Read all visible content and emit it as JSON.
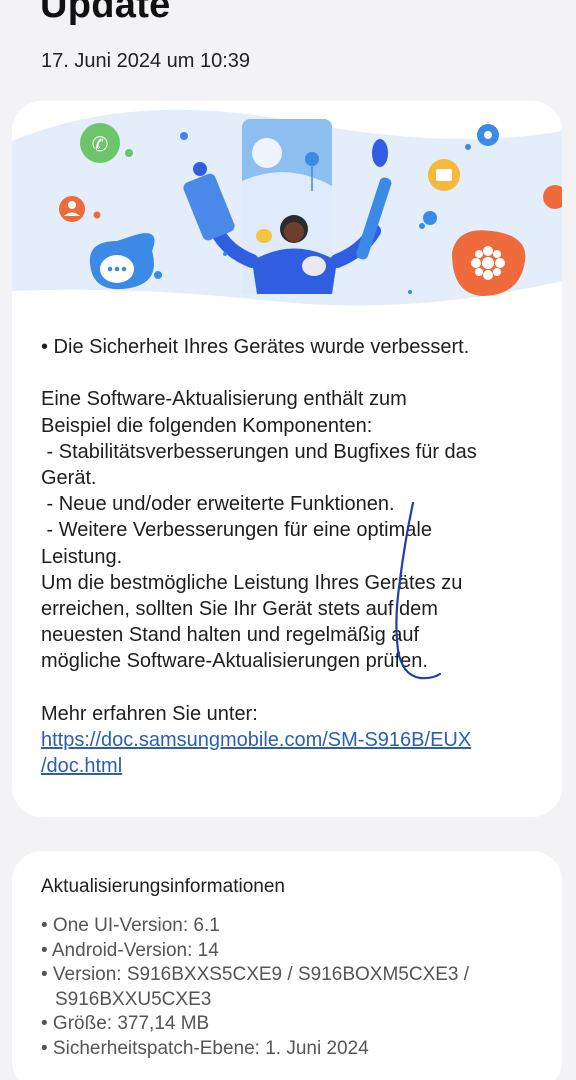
{
  "header": {
    "title": "Update",
    "date": "17. Juni 2024 um 10:39"
  },
  "notes": {
    "lines": [
      "• Die Sicherheit Ihres Gerätes wurde verbessert.",
      "",
      "Eine Software-Aktualisierung enthält zum",
      "Beispiel die folgenden Komponenten:",
      " - Stabilitätsverbesserungen und Bugfixes für das",
      "Gerät.",
      " - Neue und/oder erweiterte Funktionen.",
      " - Weitere Verbesserungen für eine optimale",
      "Leistung.",
      "Um die bestmögliche Leistung Ihres Gerätes zu",
      "erreichen, sollten Sie Ihr Gerät stets auf dem",
      "neuesten Stand halten und regelmäßig auf",
      "mögliche Software-Aktualisierungen prüfen.",
      "",
      "Mehr erfahren Sie unter:"
    ],
    "link_line1": "https://doc.samsungmobile.com/SM-S916B/EUX",
    "link_line2": "/doc.html"
  },
  "info": {
    "title": "Aktualisierungsinformationen",
    "oneui": "• One UI-Version: 6.1",
    "android": "• Android-Version: 14",
    "version_line1": "• Version: S916BXXS5CXE9 / S916BOXM5CXE3 /",
    "version_line2": "S916BXXU5CXE3",
    "size": "• Größe: 377,14 MB",
    "patch": "• Sicherheitspatch-Ebene: 1. Juni 2024"
  },
  "colors": {
    "background": "#f3f3f5",
    "card": "#ffffff",
    "link": "#2a5fb3",
    "scribble": "#1f3fa8"
  }
}
